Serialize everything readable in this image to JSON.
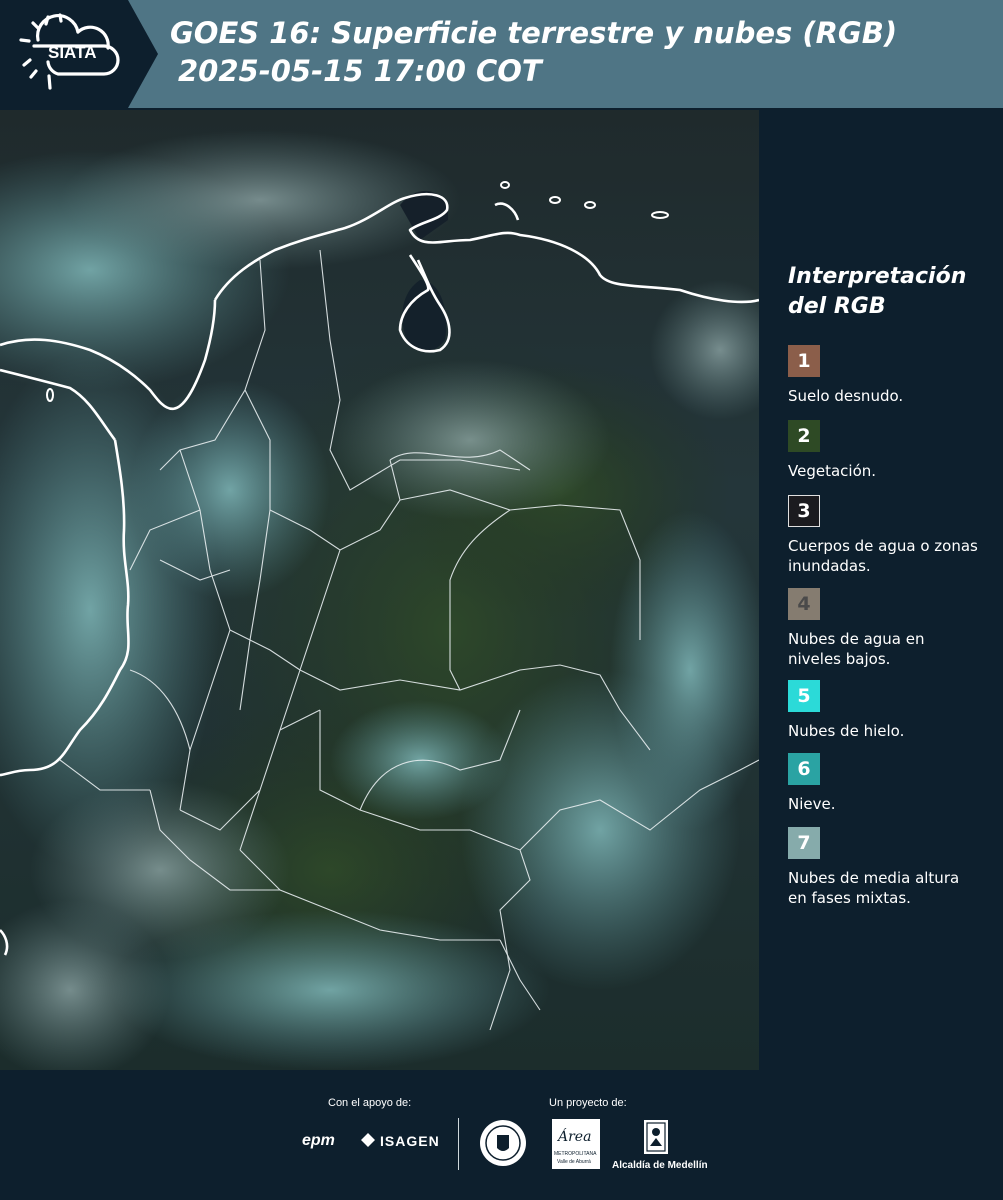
{
  "header": {
    "logo_text": "SIATA",
    "title_line1": "GOES 16: Superficie terrestre y nubes (RGB)",
    "title_line2": "2025-05-15 17:00 COT"
  },
  "legend": {
    "title_line1": "Interpretación",
    "title_line2": "del RGB",
    "items": [
      {
        "number": "1",
        "label": "Suelo desnudo.",
        "color": "#8b5e4a"
      },
      {
        "number": "2",
        "label": "Vegetación.",
        "color": "#2e4a25"
      },
      {
        "number": "3",
        "label": "Cuerpos de agua o zonas inundadas.",
        "color": "#1b1b1f"
      },
      {
        "number": "4",
        "label": "Nubes de agua en niveles bajos.",
        "color": "#857c70"
      },
      {
        "number": "5",
        "label": "Nubes de hielo.",
        "color": "#2bdad8"
      },
      {
        "number": "6",
        "label": "Nieve.",
        "color": "#2aa3a3"
      },
      {
        "number": "7",
        "label": "Nubes de media altura en fases mixtas.",
        "color": "#86abab"
      }
    ]
  },
  "footer": {
    "support_label": "Con el apoyo de:",
    "project_label": "Un proyecto de:",
    "sponsor_epm": "epm",
    "sponsor_isagen": "ISAGEN",
    "area_text": "Área",
    "area_sub1": "METROPOLITANA",
    "area_sub2": "Valle de Aburrá",
    "alcaldia": "Alcaldía de Medellín"
  },
  "colors": {
    "header_bg": "#4f7585",
    "page_bg": "#0d1f2d"
  }
}
